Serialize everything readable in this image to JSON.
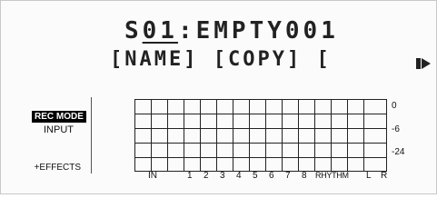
{
  "title": {
    "prefix": "S",
    "underlined": "01",
    "rest": ":EMPTY001"
  },
  "submenu": {
    "name": "[NAME]",
    "copy": "[COPY]",
    "more": "["
  },
  "left_menu": {
    "rec_mode": "REC MODE",
    "input": "INPUT",
    "effects": "+EFFECTS"
  },
  "scale": {
    "top": "0",
    "mid": "-6",
    "low": "-24"
  },
  "channels": [
    "IN",
    "1",
    "2",
    "3",
    "4",
    "5",
    "6",
    "7",
    "8",
    "RHYTHM",
    "L",
    "R"
  ]
}
